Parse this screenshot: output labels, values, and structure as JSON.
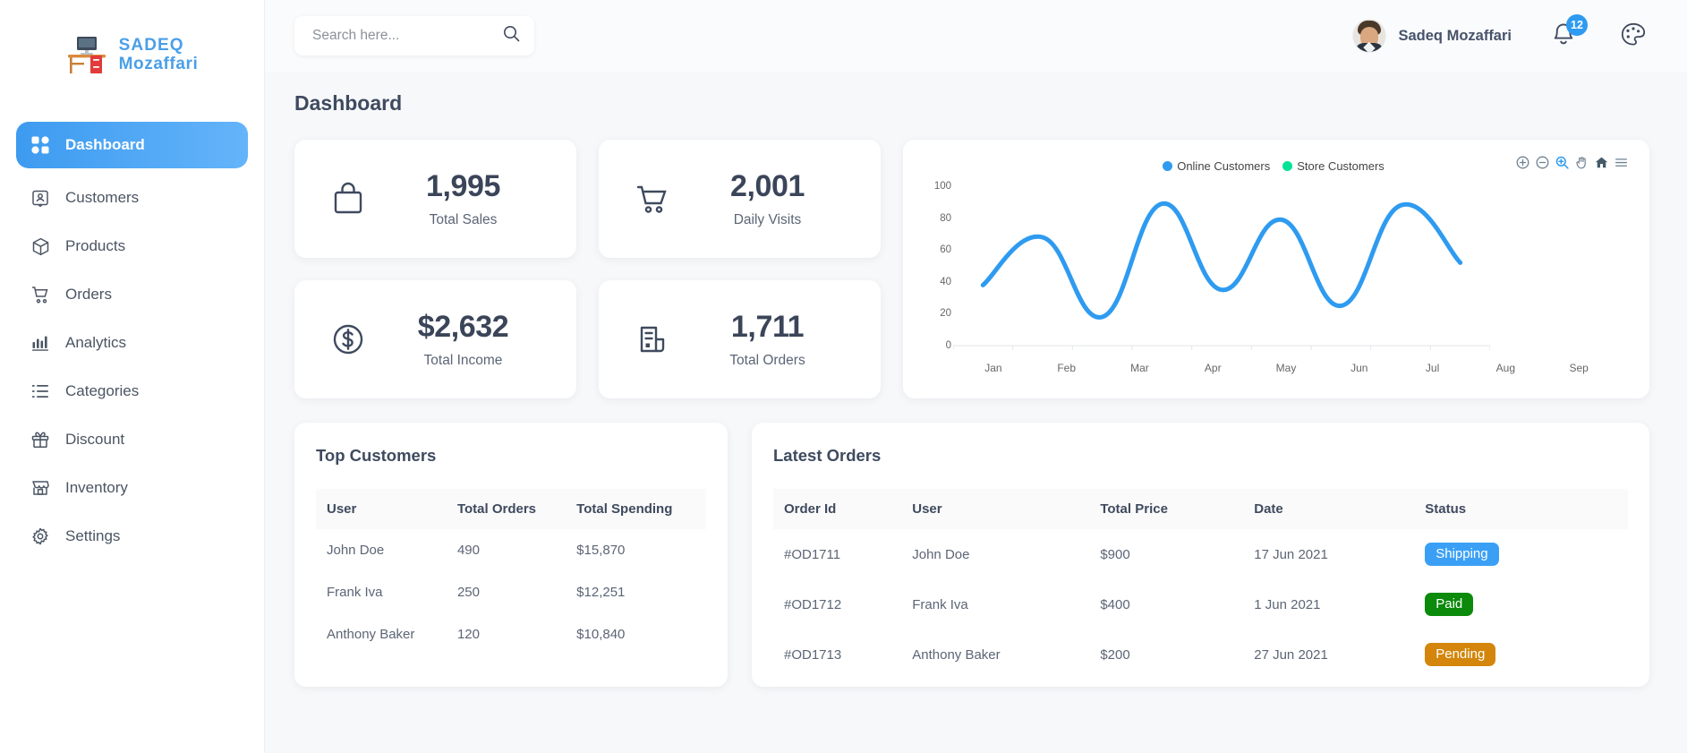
{
  "brand": {
    "line1": "SADEQ",
    "line2": "Mozaffari",
    "logo_icon": "desk-computer-icon",
    "color": "#4a9fe8"
  },
  "sidebar": {
    "items": [
      {
        "label": "Dashboard",
        "icon": "grid-icon",
        "active": true
      },
      {
        "label": "Customers",
        "icon": "contact-card-icon",
        "active": false
      },
      {
        "label": "Products",
        "icon": "box-icon",
        "active": false
      },
      {
        "label": "Orders",
        "icon": "cart-icon",
        "active": false
      },
      {
        "label": "Analytics",
        "icon": "bar-chart-icon",
        "active": false
      },
      {
        "label": "Categories",
        "icon": "list-icon",
        "active": false
      },
      {
        "label": "Discount",
        "icon": "gift-icon",
        "active": false
      },
      {
        "label": "Inventory",
        "icon": "store-icon",
        "active": false
      },
      {
        "label": "Settings",
        "icon": "gear-icon",
        "active": false
      }
    ]
  },
  "topbar": {
    "search": {
      "value": "",
      "placeholder": "Search here...",
      "icon": "search-icon"
    },
    "user": {
      "name": "Sadeq Mozaffari",
      "avatar": "user-avatar"
    },
    "notifications": {
      "icon": "bell-icon",
      "count": "12",
      "badge_color": "#2e9bf0"
    },
    "theme": {
      "icon": "palette-icon"
    }
  },
  "page": {
    "title": "Dashboard"
  },
  "stats": [
    {
      "value": "1,995",
      "label": "Total Sales",
      "icon": "shopping-bag-icon"
    },
    {
      "value": "2,001",
      "label": "Daily Visits",
      "icon": "shopping-cart-icon"
    },
    {
      "value": "$2,632",
      "label": "Total Income",
      "icon": "dollar-circle-icon"
    },
    {
      "value": "1,711",
      "label": "Total Orders",
      "icon": "invoice-icon"
    }
  ],
  "chart_toolbar": [
    {
      "icon": "zoom-in-icon",
      "active": false
    },
    {
      "icon": "zoom-out-icon",
      "active": false
    },
    {
      "icon": "selection-zoom-icon",
      "active": true
    },
    {
      "icon": "pan-icon",
      "active": false
    },
    {
      "icon": "home-reset-icon",
      "active": false
    },
    {
      "icon": "menu-icon",
      "active": false
    }
  ],
  "chart_data": {
    "type": "line",
    "title": "",
    "xlabel": "",
    "ylabel": "",
    "categories": [
      "Jan",
      "Feb",
      "Mar",
      "Apr",
      "May",
      "Jun",
      "Jul",
      "Aug",
      "Sep"
    ],
    "yticks": [
      0,
      20,
      40,
      60,
      80,
      100
    ],
    "ylim": [
      0,
      100
    ],
    "grid": false,
    "legend_position": "top-center",
    "series": [
      {
        "name": "Online Customers",
        "color": "#2e9bf0",
        "values": [
          38,
          68,
          18,
          89,
          35,
          79,
          25,
          88,
          52
        ]
      },
      {
        "name": "Store Customers",
        "color": "#00e396",
        "values": []
      }
    ]
  },
  "top_customers": {
    "title": "Top Customers",
    "columns": [
      "User",
      "Total Orders",
      "Total Spending"
    ],
    "rows": [
      [
        "John Doe",
        "490",
        "$15,870"
      ],
      [
        "Frank Iva",
        "250",
        "$12,251"
      ],
      [
        "Anthony Baker",
        "120",
        "$10,840"
      ]
    ]
  },
  "latest_orders": {
    "title": "Latest Orders",
    "columns": [
      "Order Id",
      "User",
      "Total Price",
      "Date",
      "Status"
    ],
    "rows": [
      {
        "order_id": "#OD1711",
        "user": "John Doe",
        "price": "$900",
        "date": "17 Jun 2021",
        "status": "Shipping",
        "status_color": "#3ba0f5"
      },
      {
        "order_id": "#OD1712",
        "user": "Frank Iva",
        "price": "$400",
        "date": "1 Jun 2021",
        "status": "Paid",
        "status_color": "#0b8a0b"
      },
      {
        "order_id": "#OD1713",
        "user": "Anthony Baker",
        "price": "$200",
        "date": "27 Jun 2021",
        "status": "Pending",
        "status_color": "#d3860b"
      }
    ]
  }
}
